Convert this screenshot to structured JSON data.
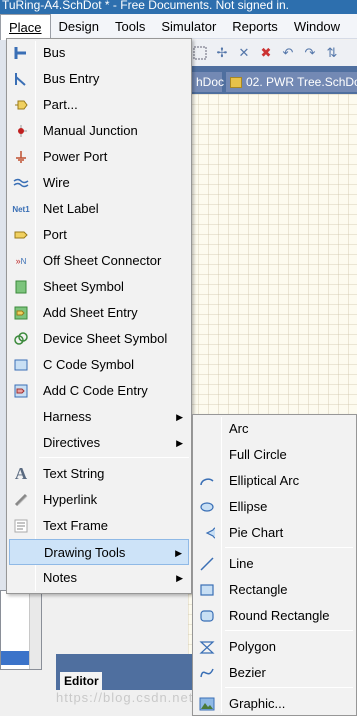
{
  "window": {
    "title": "TuRing-A4.SchDot * - Free Documents. Not signed in."
  },
  "menubar": [
    {
      "label": "Place",
      "key": "P"
    },
    {
      "label": "Design",
      "key": "D"
    },
    {
      "label": "Tools",
      "key": "T"
    },
    {
      "label": "Simulator",
      "key": "S"
    },
    {
      "label": "Reports",
      "key": "R"
    },
    {
      "label": "Window",
      "key": "W"
    }
  ],
  "doc_tabs": [
    "hDoc",
    "02. PWR Tree.SchDoc"
  ],
  "place_menu": [
    {
      "label": "Bus",
      "icon": "bus-icon"
    },
    {
      "label": "Bus Entry",
      "icon": "bus-entry-icon"
    },
    {
      "label": "Part...",
      "icon": "part-icon"
    },
    {
      "label": "Manual Junction",
      "icon": "junction-icon"
    },
    {
      "label": "Power Port",
      "icon": "power-port-icon"
    },
    {
      "label": "Wire",
      "icon": "wire-icon"
    },
    {
      "label": "Net Label",
      "icon": "net-label-icon"
    },
    {
      "label": "Port",
      "icon": "port-icon"
    },
    {
      "label": "Off Sheet Connector",
      "icon": "off-sheet-connector-icon"
    },
    {
      "label": "Sheet Symbol",
      "icon": "sheet-symbol-icon"
    },
    {
      "label": "Add Sheet Entry",
      "icon": "sheet-entry-icon"
    },
    {
      "label": "Device Sheet Symbol",
      "icon": "device-sheet-symbol-icon"
    },
    {
      "label": "C Code Symbol",
      "icon": "c-code-symbol-icon"
    },
    {
      "label": "Add C Code Entry",
      "icon": "c-code-entry-icon"
    },
    {
      "label": "Harness",
      "icon": ""
    },
    {
      "label": "Directives",
      "icon": ""
    },
    {
      "label": "Text String",
      "icon": "text-string-icon"
    },
    {
      "label": "Hyperlink",
      "icon": "hyperlink-icon"
    },
    {
      "label": "Text Frame",
      "icon": "text-frame-icon"
    },
    {
      "label": "Drawing Tools",
      "icon": ""
    },
    {
      "label": "Notes",
      "icon": ""
    }
  ],
  "drawing_tools_menu": [
    {
      "label": "Arc",
      "icon": ""
    },
    {
      "label": "Full Circle",
      "icon": ""
    },
    {
      "label": "Elliptical Arc",
      "icon": "elliptical-arc-icon"
    },
    {
      "label": "Ellipse",
      "icon": "ellipse-icon"
    },
    {
      "label": "Pie Chart",
      "icon": "pie-chart-icon"
    },
    {
      "label": "Line",
      "icon": "line-icon"
    },
    {
      "label": "Rectangle",
      "icon": "rectangle-icon"
    },
    {
      "label": "Round Rectangle",
      "icon": "round-rectangle-icon"
    },
    {
      "label": "Polygon",
      "icon": "polygon-icon"
    },
    {
      "label": "Bezier",
      "icon": "bezier-icon"
    },
    {
      "label": "Graphic...",
      "icon": "graphic-icon"
    }
  ],
  "editor_tab": "Editor",
  "watermark": "https://blog.csdn.net/qlexcel",
  "colors": {
    "highlight": "#cde3f8",
    "titlebar": "#2d6fae",
    "docstrip": "#4f6f9f"
  }
}
